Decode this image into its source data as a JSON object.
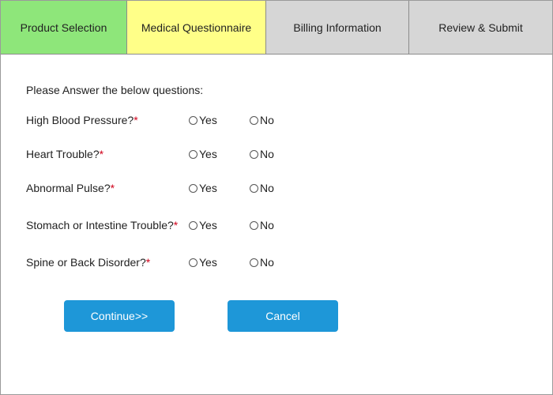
{
  "tabs": [
    {
      "label": "Product Selection",
      "color": "#8ee67a"
    },
    {
      "label": "Medical Questionnaire",
      "color": "#ffff88"
    },
    {
      "label": "Billing Information",
      "color": "#d6d6d6"
    },
    {
      "label": "Review & Submit",
      "color": "#d6d6d6"
    }
  ],
  "form": {
    "intro": "Please Answer the below questions:",
    "required_marker": "*",
    "required_color": "#d0021b",
    "questions": [
      {
        "label": "High Blood Pressure?",
        "yes": "Yes",
        "no": "No"
      },
      {
        "label": "Heart Trouble?",
        "yes": "Yes",
        "no": "No"
      },
      {
        "label": "Abnormal Pulse?",
        "yes": "Yes",
        "no": "No"
      },
      {
        "label": "Stomach or Intestine Trouble?",
        "yes": "Yes",
        "no": "No"
      },
      {
        "label": "Spine or Back Disorder?",
        "yes": "Yes",
        "no": "No"
      }
    ]
  },
  "buttons": {
    "continue_label": "Continue>>",
    "cancel_label": "Cancel",
    "color": "#1e97d8"
  }
}
